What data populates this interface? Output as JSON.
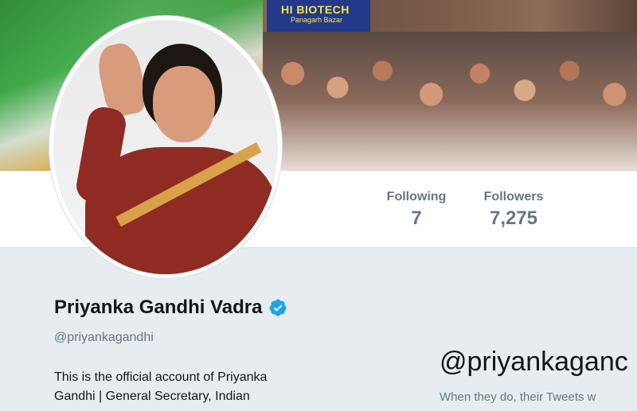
{
  "banner": {
    "sign_text": "HI BIOTECH",
    "sign_subtext": "Panagarh Bazar"
  },
  "stats": {
    "following": {
      "label": "Following",
      "value": "7"
    },
    "followers": {
      "label": "Followers",
      "value": "7,275"
    }
  },
  "profile": {
    "name": "Priyanka Gandhi Vadra",
    "handle": "@priyankagandhi",
    "bio_line1": "This is the official account of Priyanka",
    "bio_line2": "Gandhi | General Secretary, Indian",
    "verified_icon": "verified-badge-icon",
    "accent_color": "#1da1f2"
  },
  "timeline_empty": {
    "title": "@priyankaganc",
    "subtitle": "When they do, their Tweets w"
  }
}
